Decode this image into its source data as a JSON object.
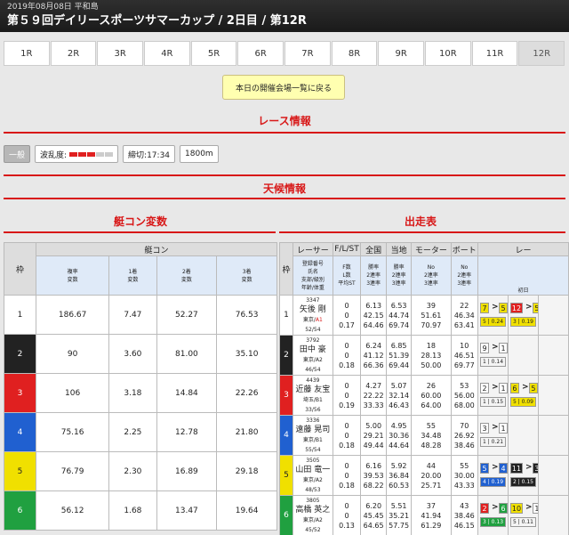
{
  "header": {
    "date": "2019年08月08日 平和島",
    "title": "第５９回デイリースポーツサマーカップ / 2日目 / 第12R"
  },
  "race_tabs": [
    "1R",
    "2R",
    "3R",
    "4R",
    "5R",
    "6R",
    "7R",
    "8R",
    "9R",
    "10R",
    "11R",
    "12R"
  ],
  "active_race": "12R",
  "back_button": "本日の開催会場一覧に戻る",
  "race_info_title": "レース情報",
  "race_info": {
    "grade": "一般",
    "wave_label": "波乱度:",
    "deadline": "締切:17:34",
    "distance": "1800m"
  },
  "weather_title": "天候情報",
  "motor_title": "艇コン変数",
  "entry_title": "出走表",
  "colors": {
    "accent": "#d81818",
    "wave_on": "#e02020",
    "wave_off": "#cccccc"
  },
  "left_table": {
    "col_waku": "枠",
    "group": "艇コン",
    "sub_headers": [
      "複率\n変数",
      "1着\n変数",
      "2着\n変数",
      "3着\n変数"
    ],
    "rows": [
      {
        "waku": "1",
        "a": "186.67",
        "b": "7.47",
        "c": "52.27",
        "d": "76.53"
      },
      {
        "waku": "2",
        "a": "90",
        "b": "3.60",
        "c": "81.00",
        "d": "35.10"
      },
      {
        "waku": "3",
        "a": "106",
        "b": "3.18",
        "c": "14.84",
        "d": "22.26"
      },
      {
        "waku": "4",
        "a": "75.16",
        "b": "2.25",
        "c": "12.78",
        "d": "21.80"
      },
      {
        "waku": "5",
        "a": "76.79",
        "b": "2.30",
        "c": "16.89",
        "d": "29.18"
      },
      {
        "waku": "6",
        "a": "56.12",
        "b": "1.68",
        "c": "13.47",
        "d": "19.64"
      }
    ]
  },
  "right_table": {
    "headers": [
      "枠",
      "レーサー",
      "F/L/ST",
      "全国",
      "当地",
      "モーター",
      "ボート",
      "レー"
    ],
    "sub_headers": [
      "登録番号\n氏名\n支部/級別\n年齢/体重",
      "F数\nL数\n平均ST",
      "勝率\n2連率\n3連率",
      "勝率\n2連率\n3連率",
      "No\n2連率\n3連率",
      "No\n2連率\n3連率",
      "初日"
    ],
    "rows": [
      {
        "waku": "1",
        "reg": "3347",
        "name": "矢後 剛",
        "branch": "東京/",
        "grade": "A1",
        "age": "52/54",
        "f": "0",
        "l": "0",
        "st": "0.17",
        "n1": "6.13",
        "n2": "42.15",
        "n3": "64.46",
        "t1": "6.53",
        "t2": "44.74",
        "t3": "69.74",
        "m1": "39",
        "m2": "51.61",
        "m3": "70.97",
        "b1": "22",
        "b2": "46.34",
        "b3": "63.41",
        "r1": {
          "c": "7",
          "c2": "5",
          "s": "5",
          "st": "0.24",
          "wk": "wk5",
          "wk2": "wk5"
        },
        "r2": {
          "c": "12",
          "c2": "5",
          "s": "3",
          "st": "0.19",
          "wk": "wk3",
          "wk2": "wk5"
        }
      },
      {
        "waku": "2",
        "reg": "3792",
        "name": "田中 豪",
        "branch": "東京/A2",
        "grade": "",
        "age": "46/54",
        "f": "0",
        "l": "0",
        "st": "0.18",
        "n1": "6.24",
        "n2": "41.12",
        "n3": "66.36",
        "t1": "6.85",
        "t2": "51.39",
        "t3": "69.44",
        "m1": "18",
        "m2": "28.13",
        "m3": "50.00",
        "b1": "10",
        "b2": "46.51",
        "b3": "69.77",
        "r1": {
          "c": "9",
          "c2": "1",
          "s": "1",
          "st": "0.14",
          "wk": "wk1",
          "wk2": "wk1"
        },
        "r2": null
      },
      {
        "waku": "3",
        "reg": "4439",
        "name": "近藤 友宝",
        "branch": "埼玉/B1",
        "grade": "",
        "age": "33/56",
        "f": "0",
        "l": "0",
        "st": "0.19",
        "n1": "4.27",
        "n2": "22.22",
        "n3": "33.33",
        "t1": "5.07",
        "t2": "32.14",
        "t3": "46.43",
        "m1": "26",
        "m2": "60.00",
        "m3": "64.00",
        "b1": "53",
        "b2": "56.00",
        "b3": "68.00",
        "r1": {
          "c": "2",
          "c2": "1",
          "s": "1",
          "st": "0.15",
          "wk": "wk1",
          "wk2": "wk1"
        },
        "r2": {
          "c": "6",
          "c2": "5",
          "s": "5",
          "st": "0.09",
          "wk": "wk5",
          "wk2": "wk5"
        }
      },
      {
        "waku": "4",
        "reg": "3336",
        "name": "遠藤 晃司",
        "branch": "東京/B1",
        "grade": "",
        "age": "55/54",
        "f": "0",
        "l": "0",
        "st": "0.18",
        "n1": "5.00",
        "n2": "29.21",
        "n3": "49.44",
        "t1": "4.95",
        "t2": "30.36",
        "t3": "44.64",
        "m1": "55",
        "m2": "34.48",
        "m3": "48.28",
        "b1": "70",
        "b2": "26.92",
        "b3": "38.46",
        "r1": {
          "c": "3",
          "c2": "1",
          "s": "1",
          "st": "0.21",
          "wk": "wk1",
          "wk2": "wk1"
        },
        "r2": null
      },
      {
        "waku": "5",
        "reg": "3505",
        "name": "山田 竜一",
        "branch": "東京/A2",
        "grade": "",
        "age": "48/53",
        "f": "0",
        "l": "0",
        "st": "0.18",
        "n1": "6.16",
        "n2": "39.53",
        "n3": "68.22",
        "t1": "5.92",
        "t2": "36.84",
        "t3": "60.53",
        "m1": "44",
        "m2": "20.00",
        "m3": "25.71",
        "b1": "55",
        "b2": "30.00",
        "b3": "43.33",
        "r1": {
          "c": "5",
          "c2": "4",
          "s": "4",
          "st": "0.19",
          "wk": "wk4",
          "wk2": "wk4"
        },
        "r2": {
          "c": "11",
          "c2": "3",
          "s": "2",
          "st": "0.15",
          "wk": "wk2",
          "wk2": "wk2"
        }
      },
      {
        "waku": "6",
        "reg": "3805",
        "name": "高橋 英之",
        "branch": "東京/A2",
        "grade": "",
        "age": "45/52",
        "f": "0",
        "l": "0",
        "st": "0.13",
        "n1": "6.20",
        "n2": "45.45",
        "n3": "64.65",
        "t1": "5.51",
        "t2": "35.21",
        "t3": "57.75",
        "m1": "37",
        "m2": "41.94",
        "m3": "61.29",
        "b1": "43",
        "b2": "38.46",
        "b3": "46.15",
        "r1": {
          "c": "2",
          "c2": "6",
          "s": "3",
          "st": "0.13",
          "wk": "wk3",
          "wk2": "wk6"
        },
        "r2": {
          "c": "10",
          "c2": "1",
          "s": "5",
          "st": "0.11",
          "wk": "wk5",
          "wk2": "wk1"
        }
      }
    ]
  }
}
